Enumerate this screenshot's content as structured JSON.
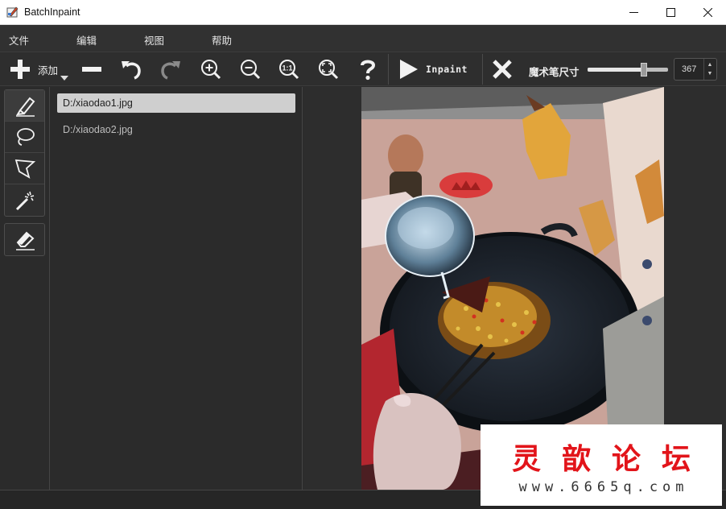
{
  "window": {
    "title": "BatchInpaint",
    "min_glyph": "—",
    "max_glyph": "☐",
    "close_glyph": "✕"
  },
  "menu": {
    "items": [
      "文件",
      "编辑",
      "视图",
      "帮助"
    ]
  },
  "toolbar": {
    "add_label": "添加",
    "inpaint_label": "Inpaint",
    "brush_size_label": "魔术笔尺寸",
    "brush_size_value": "367",
    "brush_size_fraction": 0.7,
    "icons": [
      "add-icon",
      "remove-icon",
      "undo-icon",
      "redo-icon",
      "zoom-in-icon",
      "zoom-out-icon",
      "zoom-actual-icon",
      "zoom-fit-icon",
      "help-icon",
      "play-icon",
      "cancel-icon"
    ]
  },
  "tools": {
    "icons": [
      "marker-icon",
      "lasso-icon",
      "polygon-lasso-icon",
      "magic-wand-icon",
      "eraser-icon"
    ]
  },
  "files": {
    "items": [
      "D:/xiaodao1.jpg",
      "D:/xiaodao2.jpg"
    ],
    "selected": 0
  },
  "watermark": {
    "title": "灵歆论坛",
    "url": "www.6665q.com"
  },
  "colors": {
    "background": "#2b2b2b",
    "selection": "#cfcfcf",
    "mask_red": "#d93c3c",
    "watermark_red": "#e2141a"
  }
}
